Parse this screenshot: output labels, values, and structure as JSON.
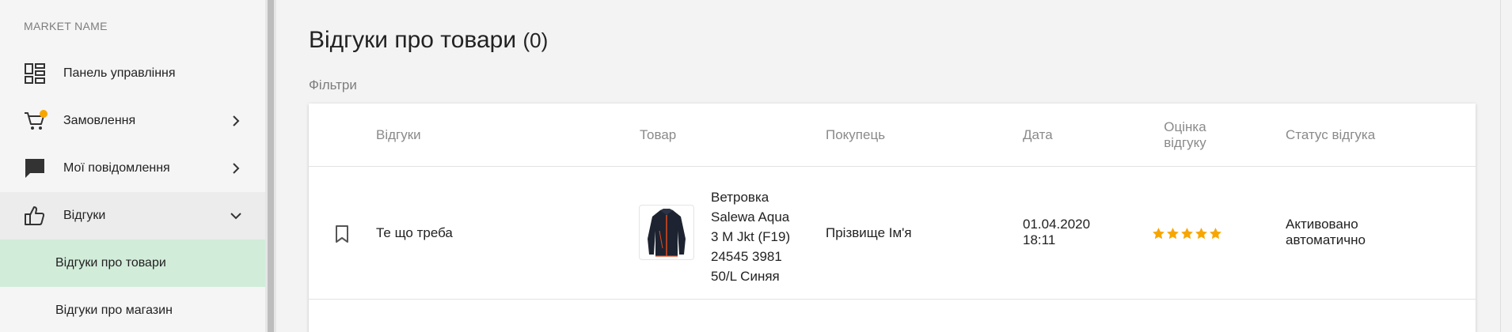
{
  "sidebar": {
    "market_name": "MARKET NAME",
    "items": [
      {
        "label": "Панель управління",
        "icon": "dashboard-icon"
      },
      {
        "label": "Замовлення",
        "icon": "cart-icon",
        "has_notification": true,
        "notification_color": "#f7a600"
      },
      {
        "label": "Мої повідомлення",
        "icon": "chat-icon"
      },
      {
        "label": "Відгуки",
        "icon": "thumbs-up-icon",
        "expanded": true
      }
    ],
    "sub_items": [
      {
        "label": "Відгуки про товари",
        "active": true
      },
      {
        "label": "Відгуки про магазин",
        "active": false
      }
    ]
  },
  "main": {
    "title": "Відгуки про товари",
    "count": "(0)",
    "filters_label": "Фільтри"
  },
  "table": {
    "headers": {
      "review": "Відгуки",
      "product": "Товар",
      "buyer": "Покупець",
      "date": "Дата",
      "rating_line1": "Оцінка",
      "rating_line2": "відгуку",
      "status": "Статус відгука"
    },
    "rows": [
      {
        "review": "Те що треба",
        "product_lines": [
          "Ветровка",
          "Salewa Aqua",
          "3 M Jkt (F19)",
          "24545 3981",
          "50/L Синяя"
        ],
        "buyer": "Прізвище Ім'я",
        "date_line1": "01.04.2020",
        "date_line2": "18:11",
        "rating": 5,
        "status_line1": "Активовано",
        "status_line2": "автоматично"
      }
    ]
  },
  "colors": {
    "accent_active_bg": "#d2ecda",
    "star": "#f7a600",
    "notification": "#f7a600"
  }
}
